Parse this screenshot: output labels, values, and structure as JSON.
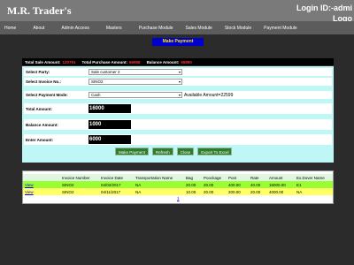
{
  "header": {
    "brand": "M.R. Trader's",
    "login_label": "Login ID:-admi",
    "login_sub": "Logo"
  },
  "nav": [
    "Home",
    "About",
    "Admin Access",
    "Masters",
    "Purchase Module",
    "Sales Module",
    "Stock Module",
    "Payment Module"
  ],
  "page_title": "Make Payment",
  "totals": {
    "sale_label": "Total Sale Amount:",
    "sale_value": "120791",
    "purchase_label": "Total Purchase Amount:",
    "purchase_value": "66958",
    "balance_label": "Balance Amount:",
    "balance_value": "55890"
  },
  "form": {
    "party_label": "Select Party:",
    "party_value": "Sale customer 2",
    "invoice_label": "Select Invoice No.:",
    "invoice_value": "SINO2",
    "mode_label": "Select Payment Mode:",
    "mode_value": "Cash",
    "available": "Available Amount=22599",
    "total_label": "Total Amount:",
    "total_value": "16000",
    "balance_label": "Balance Amount:",
    "balance_value": "1000",
    "enter_label": "Enter Amount:",
    "enter_value": "6000"
  },
  "buttons": {
    "make_payment": "Make Payment",
    "refresh": "Refresh",
    "close": "Close",
    "export": "Export To Excel"
  },
  "table": {
    "headers": [
      "Invoice Number",
      "Invoice Date",
      "Transportation Name",
      "Bag",
      "Poockage",
      "Post",
      "Rate",
      "Amount",
      "Ex.Dover Name"
    ],
    "rows": [
      {
        "action": "View",
        "cells": [
          "SINO2",
          "04/02/2017",
          "NA",
          "20.00",
          "20.00",
          "400.00",
          "40.00",
          "16000.00",
          "E1"
        ]
      },
      {
        "action": "View",
        "cells": [
          "SINO2",
          "04/11/2017",
          "NA",
          "10.00",
          "20.00",
          "200.00",
          "20.00",
          "4000.00",
          "NA"
        ]
      }
    ],
    "pager": "1"
  }
}
